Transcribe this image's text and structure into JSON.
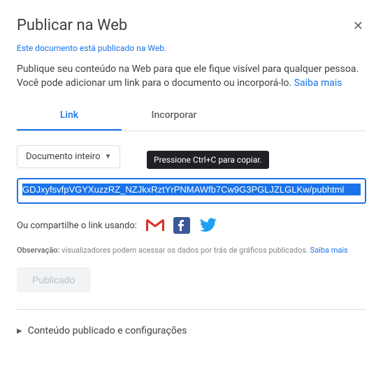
{
  "header": {
    "title": "Publicar na Web"
  },
  "status_link": "Este documento está publicado na Web.",
  "description_text": "Publique seu conteúdo na Web para que ele fique visível para qualquer pessoa. Você pode adicionar um link para o documento ou incorporá-lo. ",
  "learn_more": "Saiba mais",
  "tabs": {
    "link": "Link",
    "embed": "Incorporar"
  },
  "dropdown": {
    "selected": "Documento inteiro"
  },
  "tooltip": "Pressione Ctrl+C para copiar.",
  "link_value": "GDJxyfsvfpVGYXuzzRZ_NZJkxRztYrPNMAWfb7Cw9G3PGLJZLGLKw/pubhtml",
  "share_label": "Ou compartilhe o link usando:",
  "note": {
    "label": "Observação:",
    "text": " visualizadores podem acessar os dados por trás de gráficos publicados. ",
    "learn_more": "Saiba mais"
  },
  "published_button": "Publicado",
  "expand_section": "Conteúdo publicado e configurações"
}
